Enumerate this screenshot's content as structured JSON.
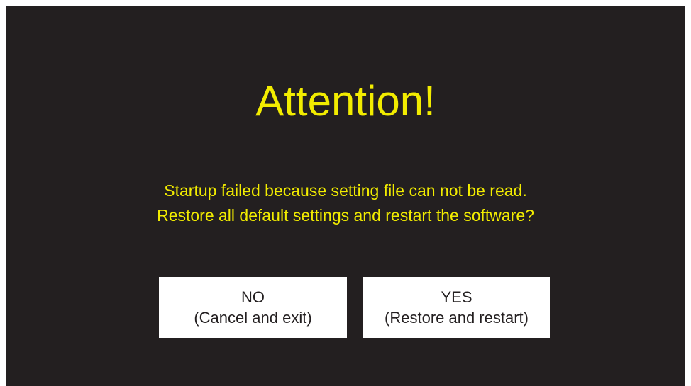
{
  "dialog": {
    "title": "Attention!",
    "message_line1": "Startup failed because setting file can not be read.",
    "message_line2": "Restore all default settings and restart the software?"
  },
  "buttons": {
    "no_label": "NO",
    "no_sublabel": "(Cancel and exit)",
    "yes_label": "YES",
    "yes_sublabel": "(Restore and restart)"
  },
  "colors": {
    "background": "#231f20",
    "text_accent": "#f2ec00",
    "button_bg": "#ffffff",
    "button_text": "#231f20"
  }
}
